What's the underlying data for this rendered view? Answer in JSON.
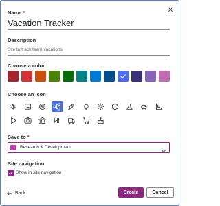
{
  "form": {
    "name_label": "Name",
    "name_required": "*",
    "name_value": "Vacation Tracker",
    "description_label": "Description",
    "description_value": "Site to track team vacations",
    "color_label": "Choose a color",
    "colors": [
      {
        "hex": "#a4262c",
        "selected": false
      },
      {
        "hex": "#d13438",
        "selected": false
      },
      {
        "hex": "#ca5010",
        "selected": false
      },
      {
        "hex": "#498205",
        "selected": false
      },
      {
        "hex": "#0b6a0b",
        "selected": false
      },
      {
        "hex": "#038387",
        "selected": false
      },
      {
        "hex": "#0078d4",
        "selected": false
      },
      {
        "hex": "#004e8c",
        "selected": false
      },
      {
        "hex": "#4f6bed",
        "selected": true
      },
      {
        "hex": "#373277",
        "selected": false
      },
      {
        "hex": "#8764b8",
        "selected": false
      },
      {
        "hex": "#c06bb4",
        "selected": false
      }
    ],
    "icon_label": "Choose an icon",
    "icons": [
      "bug-icon",
      "id-card-icon",
      "target-icon",
      "flow-icon",
      "rocket-icon",
      "lightbulb-icon",
      "settings-icon",
      "cube-icon",
      "flask-icon",
      "piggy-bank-icon",
      "triangle-icon",
      "play-icon",
      "camera-icon",
      "bank-icon",
      "tally-icon",
      "vehicle-icon",
      "cart-icon",
      "cake-icon"
    ],
    "selected_icon": "flow-icon",
    "save_to_label": "Save to",
    "save_to_required": "*",
    "save_to_value": "Research & Development",
    "site_nav_label": "Site navigation",
    "show_in_nav_label": "Show in site navigation",
    "show_in_nav_checked": true
  },
  "footer": {
    "back_label": "Back",
    "create_label": "Create",
    "cancel_label": "Cancel"
  },
  "theme": {
    "accent": "#8a2a7f",
    "selected_icon_bg": "#4a6ee0",
    "site_dot": "#c239b3"
  }
}
